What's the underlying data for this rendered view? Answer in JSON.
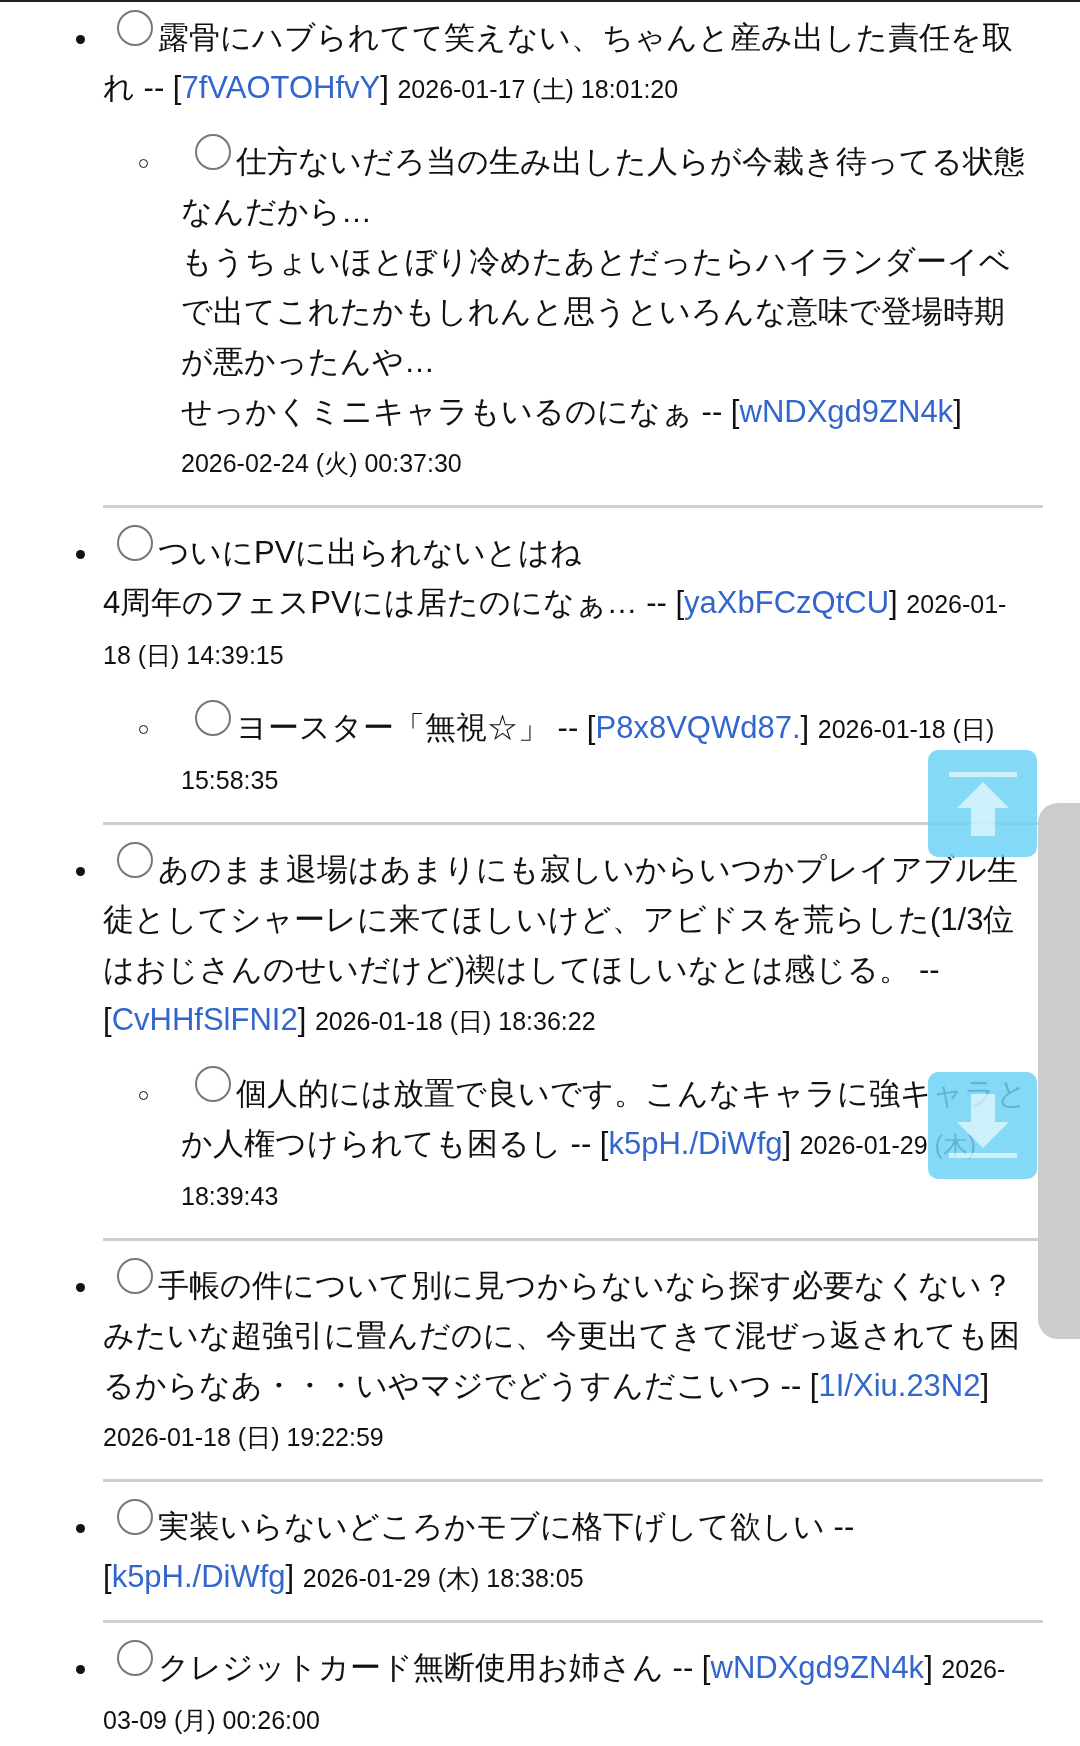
{
  "comments": [
    {
      "selected": false,
      "lines": [
        "露骨にハブられてて笑えない、ちゃんと産み出した責任を取れ"
      ],
      "lead": "--",
      "open": "[",
      "author": "7fVAOTOHfvY",
      "close": "]",
      "date": "2026-01-17 (土) 18:01:20",
      "replies": [
        {
          "selected": false,
          "lines": [
            "仕方ないだろ当の生み出した人らが今裁き待ってる状態なんだから…",
            "もうちょいほとぼり冷めたあとだったらハイランダーイベで出てこれたかもしれんと思うといろんな意味で登場時期が悪かったんや…",
            "せっかくミニキャラもいるのになぁ"
          ],
          "lead": "--",
          "open": "[",
          "author": "wNDXgd9ZN4k",
          "close": "]",
          "date": "2026-02-24 (火) 00:37:30"
        }
      ]
    },
    {
      "selected": false,
      "lines": [
        "ついにPVに出られないとはね",
        "4周年のフェスPVには居たのになぁ…"
      ],
      "lead": "--",
      "open": "[",
      "author": "yaXbFCzQtCU",
      "close": "]",
      "date": "2026-01-18 (日) 14:39:15",
      "replies": [
        {
          "selected": false,
          "lines": [
            "ヨースター「無視☆」"
          ],
          "lead": "--",
          "open": "[",
          "author": "P8x8VQWd87.",
          "close": "]",
          "date": "2026-01-18 (日) 15:58:35"
        }
      ]
    },
    {
      "selected": false,
      "lines": [
        "あのまま退場はあまりにも寂しいからいつかプレイアブル生徒としてシャーレに来てほしいけど、アビドスを荒らした(1/3位はおじさんのせいだけど)禊はしてほしいなとは感じる。"
      ],
      "lead": "--",
      "open": "[",
      "author": "CvHHfSlFNI2",
      "close": "]",
      "date": "2026-01-18 (日) 18:36:22",
      "replies": [
        {
          "selected": false,
          "lines": [
            "個人的には放置で良いです。こんなキャラに強キャラとか人権つけられても困るし"
          ],
          "lead": "--",
          "open": "[",
          "author": "k5pH./DiWfg",
          "close": "]",
          "date": "2026-01-29 (木) 18:39:43"
        }
      ]
    },
    {
      "selected": false,
      "lines": [
        "手帳の件について別に見つからないなら探す必要なくない？みたいな超強引に畳んだのに、今更出てきて混ぜっ返されても困るからなあ・・・いやマジでどうすんだこいつ"
      ],
      "lead": "--",
      "open": "[",
      "author": "1I/Xiu.23N2",
      "close": "]",
      "date": "2026-01-18 (日) 19:22:59"
    },
    {
      "selected": false,
      "lines": [
        "実装いらないどころかモブに格下げして欲しい"
      ],
      "lead": "--",
      "open": "[",
      "author": "k5pH./DiWfg",
      "close": "]",
      "date": "2026-01-29 (木) 18:38:05"
    },
    {
      "selected": false,
      "lines": [
        "クレジットカード無断使用お姉さん"
      ],
      "lead": "--",
      "open": "[",
      "author": "wNDXgd9ZN4k",
      "close": "]",
      "date": "2026-03-09 (月) 00:26:00"
    }
  ]
}
